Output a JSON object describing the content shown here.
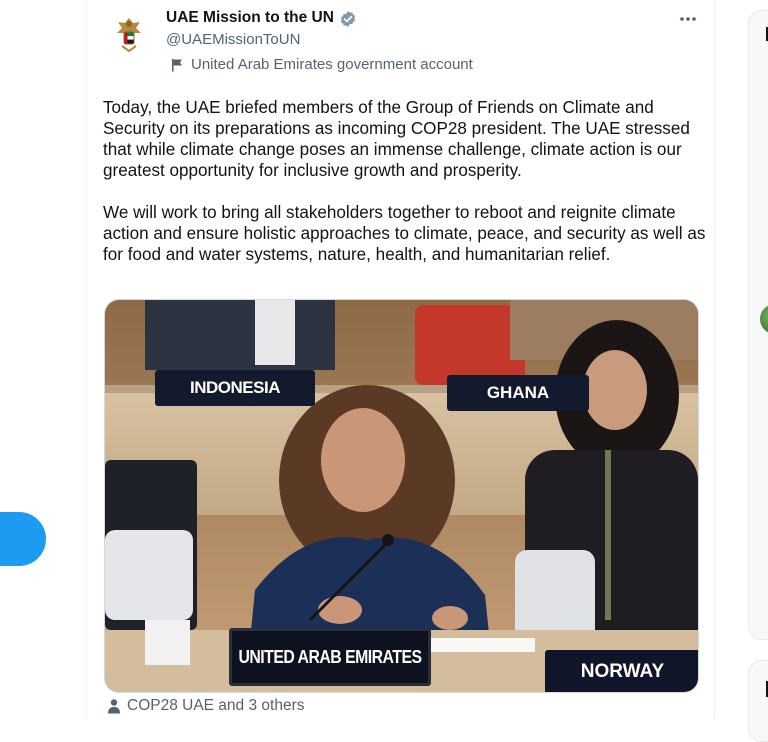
{
  "tweet": {
    "display_name": "UAE Mission to the UN",
    "handle": "@UAEMissionToUN",
    "gov_label": "United Arab Emirates government account",
    "paragraphs": [
      "Today, the UAE briefed members of the Group of Friends on Climate and Security on its preparations as incoming COP28 president. The UAE stressed that while climate change poses an immense challenge, climate action is our greatest opportunity for inclusive growth and prosperity.",
      "We will work to bring all stakeholders together to reboot and reignite climate action and ensure holistic approaches to climate, peace, and security as well as for food and water systems, nature, health, and humanitarian relief."
    ],
    "tagged": "COP28 UAE and 3 others",
    "photo": {
      "placards": [
        "INDONESIA",
        "GHANA",
        "UNITED ARAB EMIRATES",
        "NORWAY"
      ]
    }
  },
  "icons": {
    "verified": "verified-badge-icon",
    "gov_flag": "flag-icon",
    "more": "more-horizontal-icon",
    "tagged": "person-icon"
  },
  "colors": {
    "accent": "#1d9bf0",
    "text_primary": "#0f1419",
    "text_secondary": "#536471",
    "verified_badge": "#829aab"
  }
}
